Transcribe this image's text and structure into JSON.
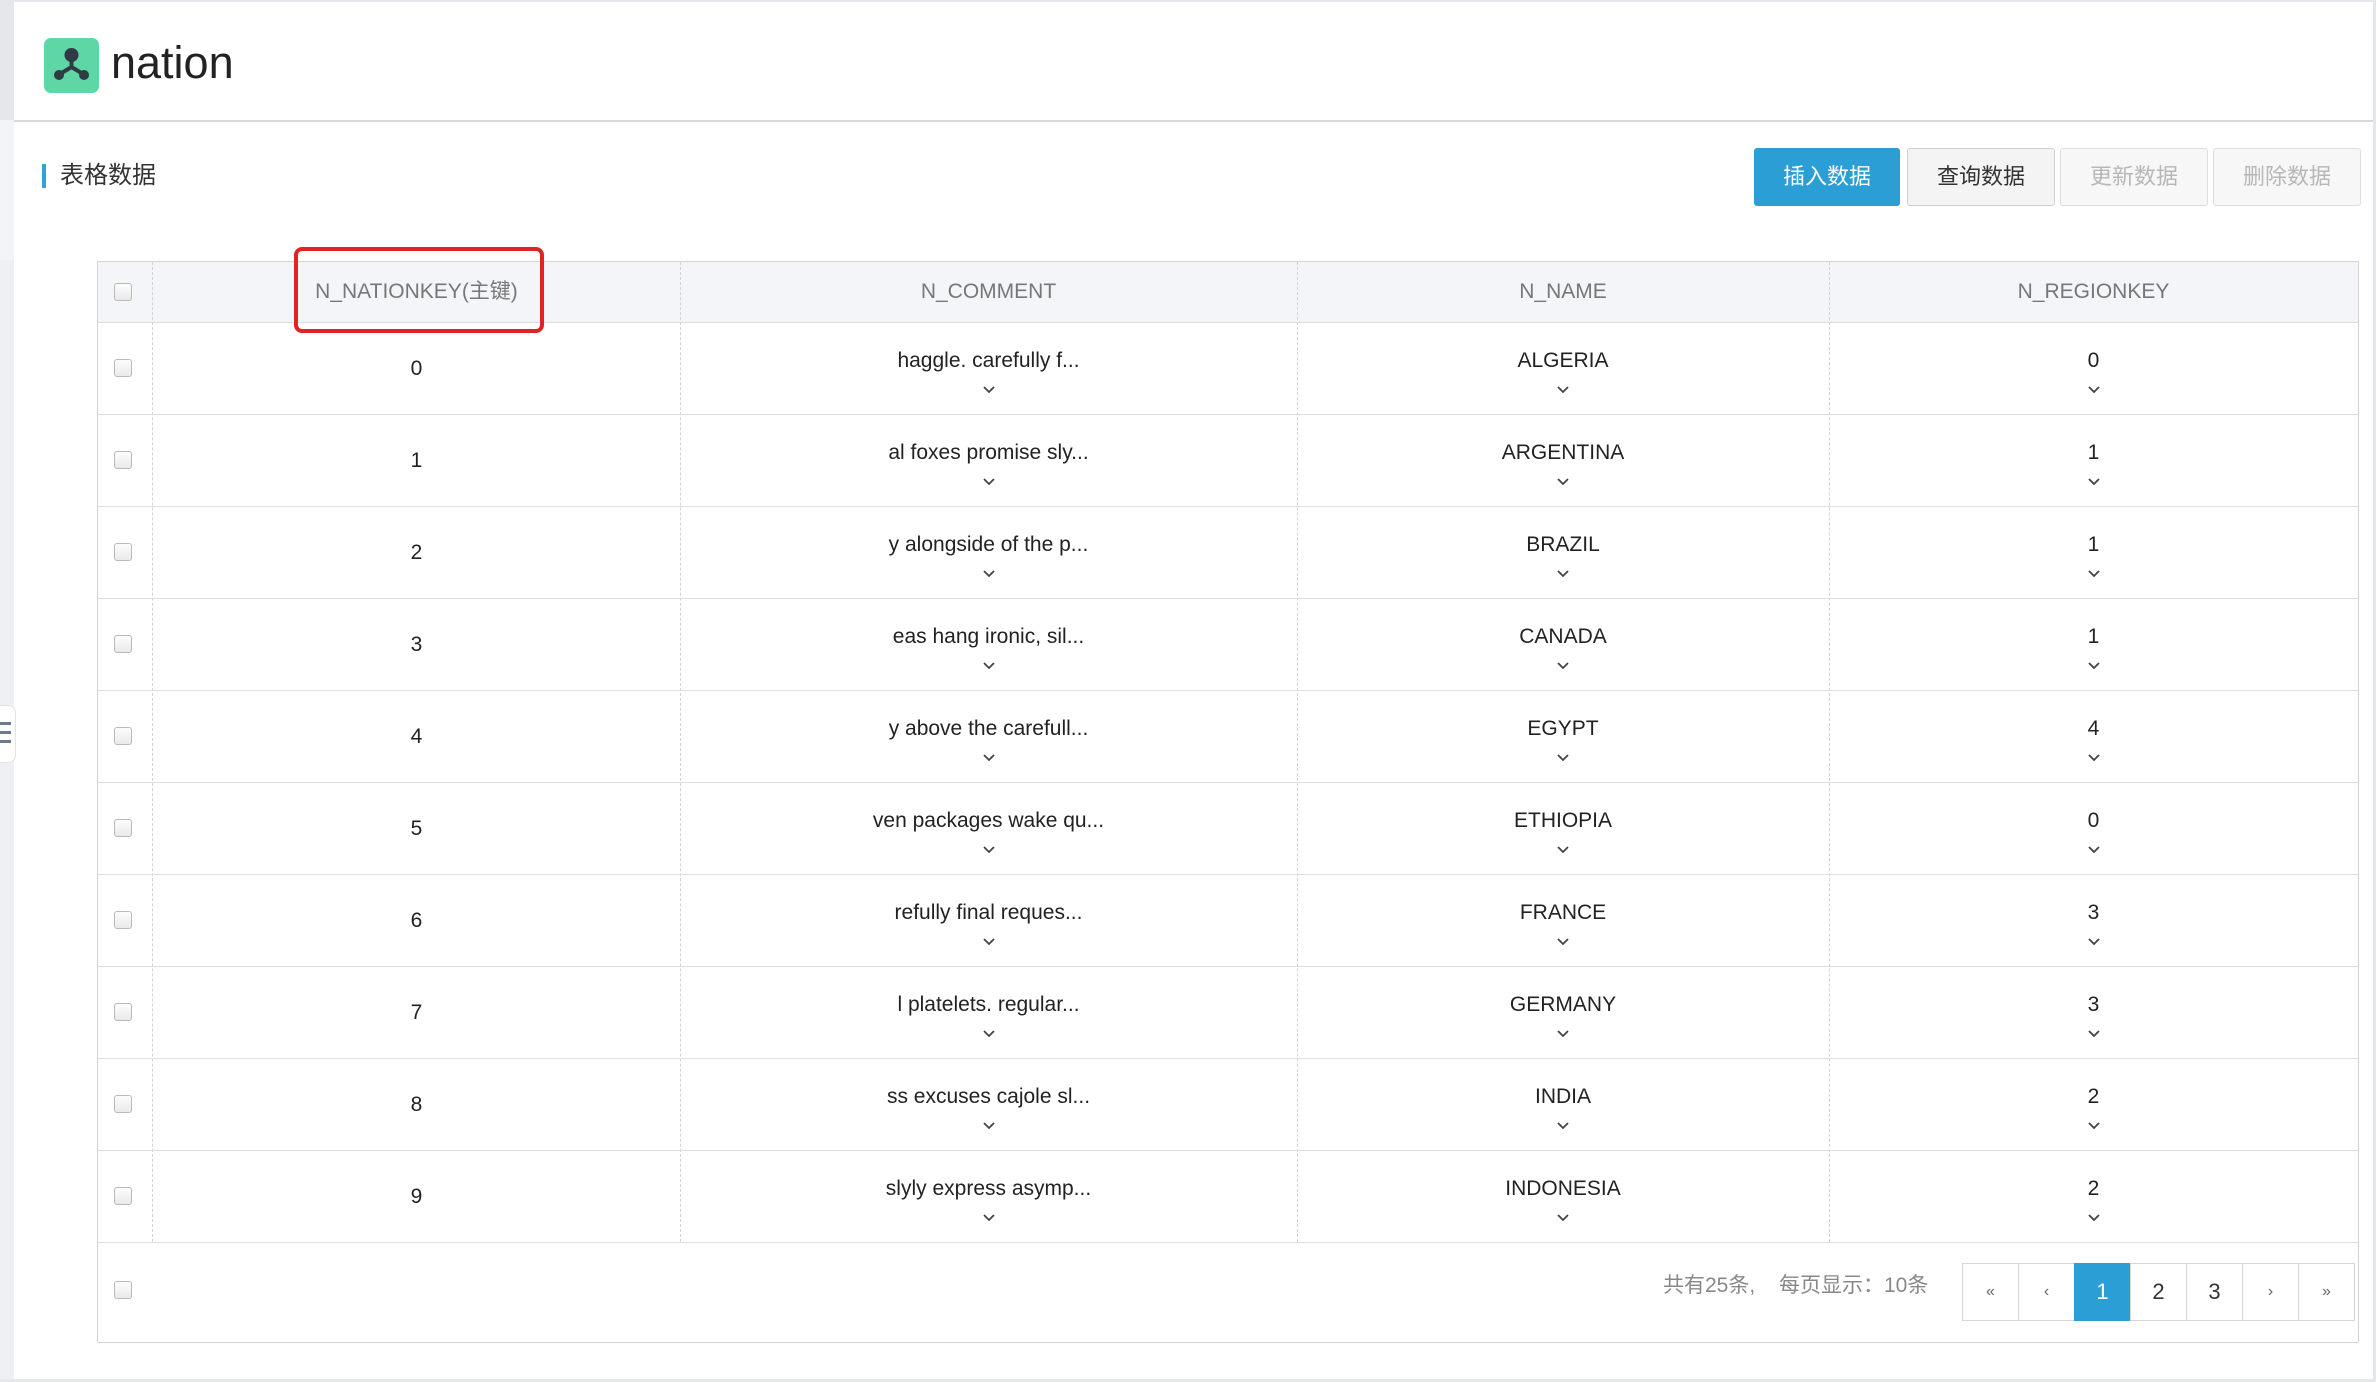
{
  "app": {
    "title": "nation",
    "icon": "share-nodes-icon",
    "accent_color": "#5fd6a6"
  },
  "section": {
    "title": "表格数据"
  },
  "actions": {
    "insert": "插入数据",
    "query": "查询数据",
    "update": "更新数据",
    "delete": "删除数据"
  },
  "table": {
    "columns": [
      "N_NATIONKEY(主键)",
      "N_COMMENT",
      "N_NAME",
      "N_REGIONKEY"
    ],
    "rows": [
      {
        "key": "0",
        "comment": "haggle. carefully f...",
        "name": "ALGERIA",
        "region": "0"
      },
      {
        "key": "1",
        "comment": "al foxes promise sly...",
        "name": "ARGENTINA",
        "region": "1"
      },
      {
        "key": "2",
        "comment": "y alongside of the p...",
        "name": "BRAZIL",
        "region": "1"
      },
      {
        "key": "3",
        "comment": "eas hang ironic, sil...",
        "name": "CANADA",
        "region": "1"
      },
      {
        "key": "4",
        "comment": "y above the carefull...",
        "name": "EGYPT",
        "region": "4"
      },
      {
        "key": "5",
        "comment": "ven packages wake qu...",
        "name": "ETHIOPIA",
        "region": "0"
      },
      {
        "key": "6",
        "comment": "refully final reques...",
        "name": "FRANCE",
        "region": "3"
      },
      {
        "key": "7",
        "comment": "l platelets. regular...",
        "name": "GERMANY",
        "region": "3"
      },
      {
        "key": "8",
        "comment": "ss excuses cajole sl...",
        "name": "INDIA",
        "region": "2"
      },
      {
        "key": "9",
        "comment": "slyly express asymp...",
        "name": "INDONESIA",
        "region": "2"
      }
    ]
  },
  "footer": {
    "total": "共有25条,",
    "page_size": "每页显示：10条",
    "first": "«",
    "prev": "‹",
    "pages": [
      "1",
      "2",
      "3"
    ],
    "current_page": "1",
    "next": "›",
    "last": "»"
  },
  "colors": {
    "primary": "#2b9ed6",
    "highlight": "#e02424"
  }
}
